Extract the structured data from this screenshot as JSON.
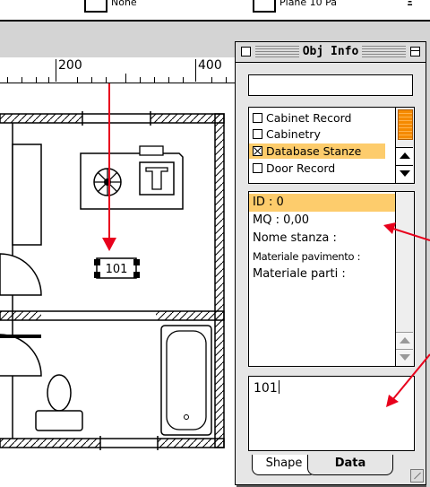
{
  "toolbar": {
    "item1": "None",
    "item2": "Plane 10 Pa"
  },
  "ruler": {
    "labels": [
      "200",
      "400"
    ]
  },
  "floorplan": {
    "room_id_tag": "101"
  },
  "palette": {
    "title": "Obj Info",
    "name_field_value": "",
    "records": [
      {
        "label": "Cabinet Record",
        "checked": false
      },
      {
        "label": "Cabinetry",
        "checked": false
      },
      {
        "label": "Database Stanze",
        "checked": true
      },
      {
        "label": "Door Record",
        "checked": false
      }
    ],
    "fields": [
      {
        "label": "ID : 0",
        "selected": true
      },
      {
        "label": "MQ : 0,00",
        "selected": false
      },
      {
        "label": "Nome stanza :",
        "selected": false
      },
      {
        "label": "Materiale pavimento :",
        "selected": false
      },
      {
        "label": "Materiale parti :",
        "selected": false
      }
    ],
    "value": "101",
    "tabs": {
      "shape": "Shape",
      "data": "Data"
    }
  },
  "colors": {
    "highlight": "#fdcc6c",
    "arrow": "#e8001c",
    "scroll_thumb": "#f58a00"
  }
}
